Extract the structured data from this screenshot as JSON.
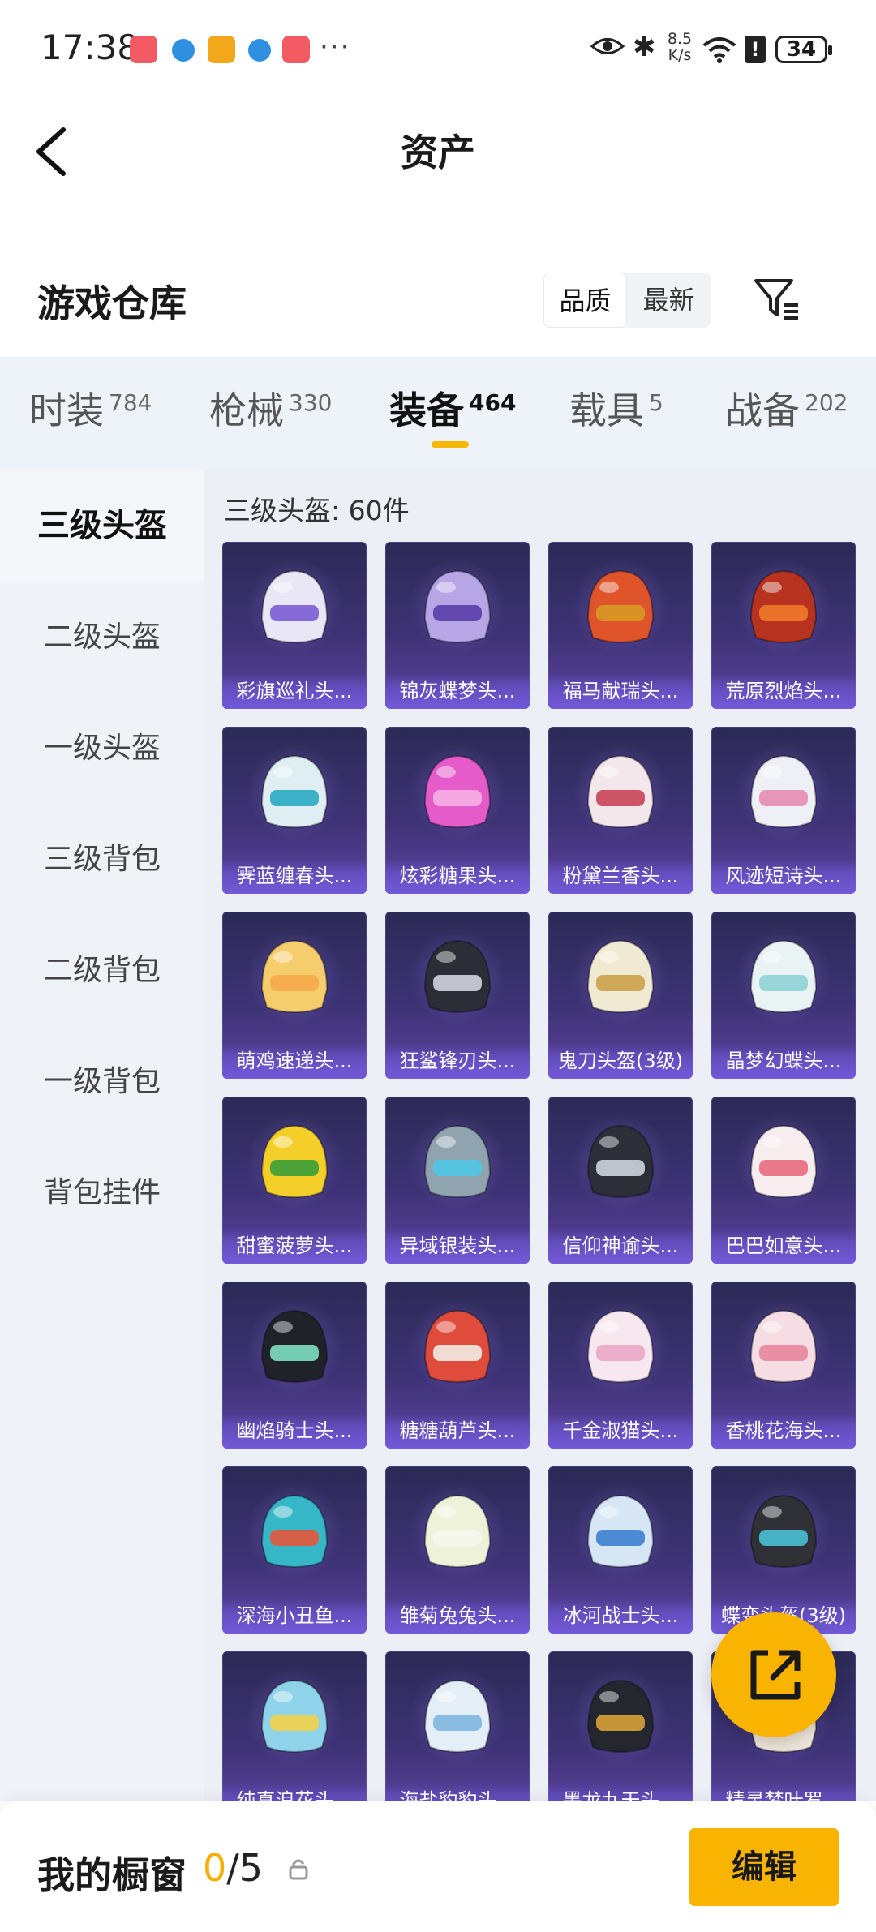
{
  "status_bar": {
    "time": "17:38",
    "net_speed_value": "8.5",
    "net_speed_unit": "K/s",
    "battery": "34",
    "more": "···"
  },
  "header": {
    "title": "资产"
  },
  "warehouse": {
    "title": "游戏仓库",
    "sort_options": [
      "品质",
      "最新"
    ],
    "active_sort": "品质"
  },
  "categories": [
    {
      "label": "时装",
      "count": "784"
    },
    {
      "label": "枪械",
      "count": "330"
    },
    {
      "label": "装备",
      "count": "464"
    },
    {
      "label": "载具",
      "count": "5"
    },
    {
      "label": "战备",
      "count": "202"
    }
  ],
  "active_category": "装备",
  "sidebar": {
    "items": [
      "三级头盔",
      "二级头盔",
      "一级头盔",
      "三级背包",
      "二级背包",
      "一级背包",
      "背包挂件"
    ],
    "active": "三级头盔"
  },
  "content": {
    "heading": "三级头盔: 60件"
  },
  "items": [
    {
      "name": "彩旗巡礼头...",
      "color": "#e9e6f5",
      "accent": "#7b5cd6"
    },
    {
      "name": "锦灰蝶梦头...",
      "color": "#b7a6e6",
      "accent": "#5a3fa8"
    },
    {
      "name": "福马献瑞头...",
      "color": "#e0542b",
      "accent": "#d89a24"
    },
    {
      "name": "荒原烈焰头...",
      "color": "#b8331f",
      "accent": "#f07a2a"
    },
    {
      "name": "霁蓝缠春头...",
      "color": "#dfeef2",
      "accent": "#2aa7c4"
    },
    {
      "name": "炫彩糖果头...",
      "color": "#e45bc9",
      "accent": "#f7b0e6"
    },
    {
      "name": "粉黛兰香头...",
      "color": "#f3e7ec",
      "accent": "#c94456"
    },
    {
      "name": "风迹短诗头...",
      "color": "#eef0f6",
      "accent": "#e48db2"
    },
    {
      "name": "萌鸡速递头...",
      "color": "#f6cd6c",
      "accent": "#f7a84a"
    },
    {
      "name": "狂鲨锋刃头...",
      "color": "#2b2e36",
      "accent": "#d0d4dc"
    },
    {
      "name": "鬼刀头盔(3级)",
      "color": "#f1ead3",
      "accent": "#c9a24a"
    },
    {
      "name": "晶梦幻蝶头...",
      "color": "#e9f3f4",
      "accent": "#8fd3d6"
    },
    {
      "name": "甜蜜菠萝头...",
      "color": "#f4cf2a",
      "accent": "#3a9e3a"
    },
    {
      "name": "异域银装头...",
      "color": "#8fa4ae",
      "accent": "#4cc6e4"
    },
    {
      "name": "信仰神谕头...",
      "color": "#2d2f38",
      "accent": "#cfd4de"
    },
    {
      "name": "巴巴如意头...",
      "color": "#f7ecee",
      "accent": "#e86c7e"
    },
    {
      "name": "幽焰骑士头...",
      "color": "#1f2229",
      "accent": "#7ee0c0"
    },
    {
      "name": "糖糖葫芦头...",
      "color": "#e04c3b",
      "accent": "#f3ece4"
    },
    {
      "name": "千金淑猫头...",
      "color": "#f7e8ef",
      "accent": "#e9a6c4"
    },
    {
      "name": "香桃花海头...",
      "color": "#f6dde4",
      "accent": "#e7859d"
    },
    {
      "name": "深海小丑鱼...",
      "color": "#36b7c8",
      "accent": "#e6563a"
    },
    {
      "name": "雏菊兔兔头...",
      "color": "#eef2d9",
      "accent": "#f5f7ee"
    },
    {
      "name": "冰河战士头...",
      "color": "#d6e6f4",
      "accent": "#3d7fd0"
    },
    {
      "name": "蝶变头盔(3级)",
      "color": "#2f3137",
      "accent": "#4ac0d6"
    },
    {
      "name": "纯真浪花头...",
      "color": "#8fd3ea",
      "accent": "#f3d24a"
    },
    {
      "name": "海盐豹豹头...",
      "color": "#e4eef6",
      "accent": "#7fb6e0"
    },
    {
      "name": "墨龙九天头...",
      "color": "#25272e",
      "accent": "#d9a23a"
    },
    {
      "name": "精灵梦叶罗...",
      "color": "#eee6da",
      "accent": "#c9b08a"
    }
  ],
  "bottom": {
    "label": "我的橱窗",
    "count_current": "0",
    "count_total": "/5",
    "edit": "编辑"
  }
}
